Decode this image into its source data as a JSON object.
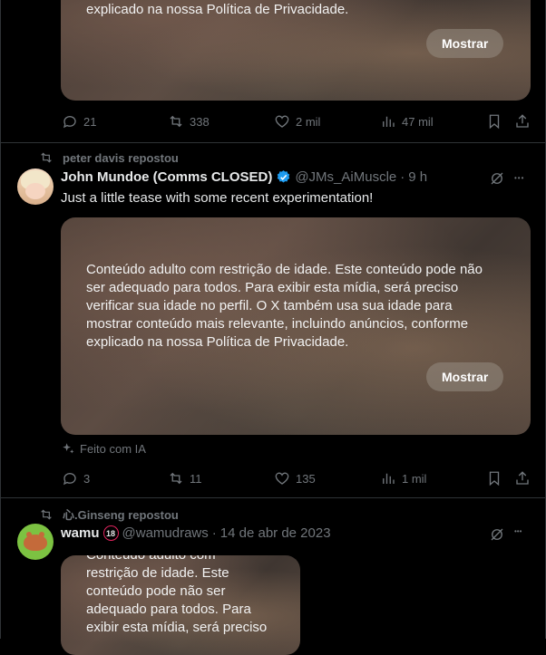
{
  "post1": {
    "media_last_line": "explicado na nossa Política de Privacidade.",
    "show_label": "Mostrar",
    "replies": "21",
    "reposts": "338",
    "likes": "2 mil",
    "views": "47 mil"
  },
  "post2": {
    "reposted_by": "peter davis repostou",
    "name": "John Mundoe (Comms CLOSED)",
    "handle": "@JMs_AiMuscle",
    "dot": "·",
    "time": "9 h",
    "text": "Just a little tease with some recent experimentation!",
    "media_lines": [
      "Conteúdo adulto com restrição de idade. Este conteúdo pode não",
      "ser adequado para todos. Para exibir esta mídia, será preciso",
      "verificar sua idade no perfil. O X também usa sua idade para",
      "mostrar conteúdo mais relevante, incluindo anúncios, conforme",
      "explicado na nossa Política de Privacidade."
    ],
    "show_label": "Mostrar",
    "ai_label": "Feito com IA",
    "replies": "3",
    "reposts": "11",
    "likes": "135",
    "views": "1 mil"
  },
  "post3": {
    "reposted_by": "心.Ginseng repostou",
    "name": "wamu",
    "badge": "18",
    "handle": "@wamudraws",
    "dot": "·",
    "time": "14 de abr de 2023",
    "media_lines": [
      "Conteúdo adulto com",
      "restrição de idade. Este",
      "conteúdo pode não ser",
      "adequado para todos. Para",
      "exibir esta mídia, será preciso"
    ]
  },
  "colors": {
    "background": "#000000",
    "text": "#e7e9ea",
    "muted": "#71767b",
    "verified": "#1d9bf0",
    "border": "#2f3336"
  }
}
